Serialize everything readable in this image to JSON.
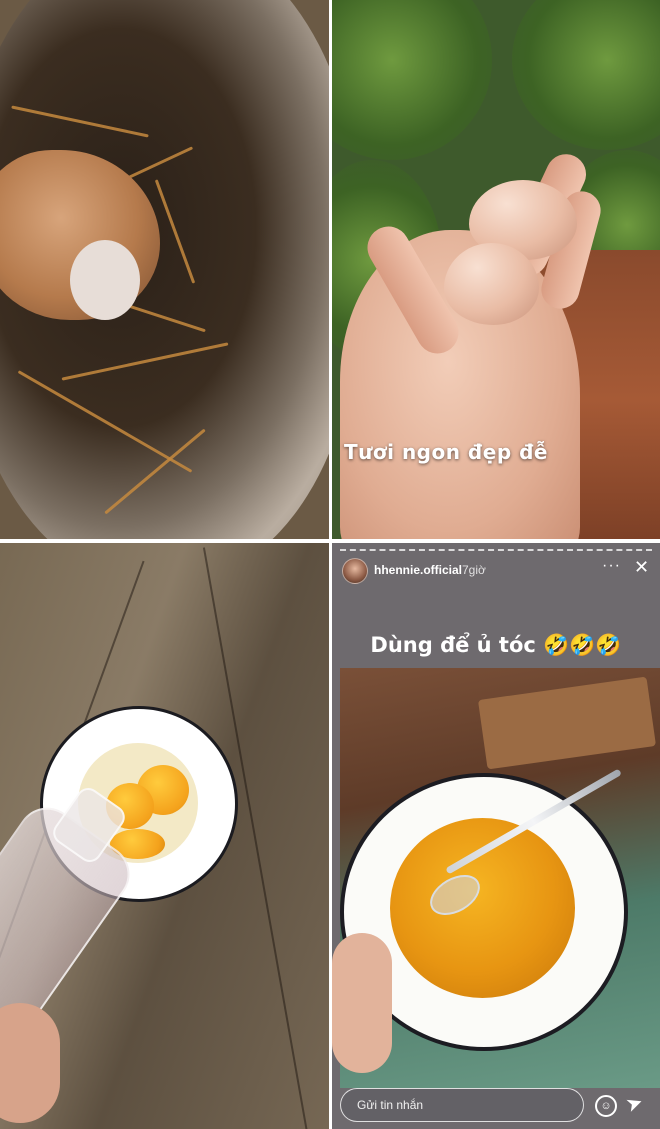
{
  "panel2": {
    "caption": "Tươi ngon đẹp đễ"
  },
  "story": {
    "username": "hhennie.official",
    "time_ago": "7giờ",
    "more_icon": "more-horizontal-icon",
    "more_glyph": "···",
    "close_icon": "close-icon",
    "close_glyph": "✕",
    "headline": "Dùng để ủ tóc 🤣🤣🤣",
    "message_placeholder": "Gửi tin nhắn",
    "emoji_icon": "emoji-icon",
    "emoji_glyph": "☺",
    "send_icon": "send-icon",
    "send_glyph": "➤"
  }
}
